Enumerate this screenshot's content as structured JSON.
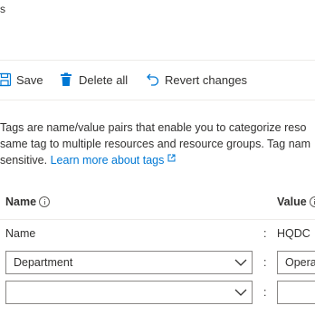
{
  "header": {
    "title": "s"
  },
  "toolbar": {
    "save_label": "Save",
    "delete_all_label": "Delete all",
    "revert_label": "Revert changes"
  },
  "description": {
    "line1": "Tags are name/value pairs that enable you to categorize reso",
    "line2": "same tag to multiple resources and resource groups. Tag nam",
    "line3_prefix": "sensitive. ",
    "link_text": "Learn more about tags"
  },
  "table": {
    "name_header": "Name",
    "value_header": "Value",
    "rows": [
      {
        "name": "Name",
        "separator": ":",
        "value": "HQDC"
      },
      {
        "name": "Department",
        "separator": ":",
        "value": "Opera"
      },
      {
        "name": "",
        "separator": ":",
        "value": ""
      }
    ]
  },
  "colors": {
    "accent": "#0078d4",
    "text": "#323130",
    "border": "#8a8886"
  }
}
